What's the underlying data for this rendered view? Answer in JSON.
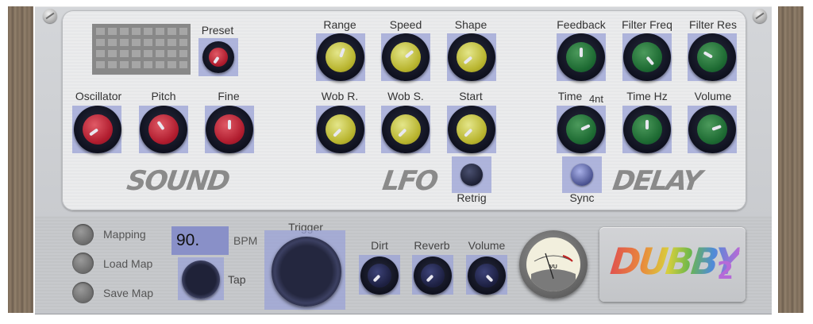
{
  "sound": {
    "section_label": "SOUND",
    "preset_label": "Preset",
    "oscillator_label": "Oscillator",
    "pitch_label": "Pitch",
    "fine_label": "Fine"
  },
  "lfo": {
    "section_label": "LFO",
    "range_label": "Range",
    "speed_label": "Speed",
    "shape_label": "Shape",
    "wobr_label": "Wob R.",
    "wobs_label": "Wob S.",
    "start_label": "Start",
    "retrig_label": "Retrig"
  },
  "delay": {
    "section_label": "DELAY",
    "feedback_label": "Feedback",
    "filterfreq_label": "Filter Freq",
    "filterres_label": "Filter Res",
    "time_label": "Time",
    "time_value": "4nt",
    "timehz_label": "Time Hz",
    "volume_label": "Volume",
    "sync_label": "Sync"
  },
  "bottom": {
    "mapping_label": "Mapping",
    "loadmap_label": "Load Map",
    "savemap_label": "Save Map",
    "bpm_value": "90.",
    "bpm_label": "BPM",
    "tap_label": "Tap",
    "trigger_label": "Trigger",
    "dirt_label": "Dirt",
    "reverb_label": "Reverb",
    "volume_label": "Volume",
    "vu_label": "VU"
  },
  "logo": {
    "text": "DUBBY",
    "version": "2"
  },
  "colors": {
    "highlight": "#9aa1d6",
    "sound_knob": "#b01c2e",
    "lfo_knob": "#b8b42e",
    "delay_knob": "#1d6a32"
  }
}
